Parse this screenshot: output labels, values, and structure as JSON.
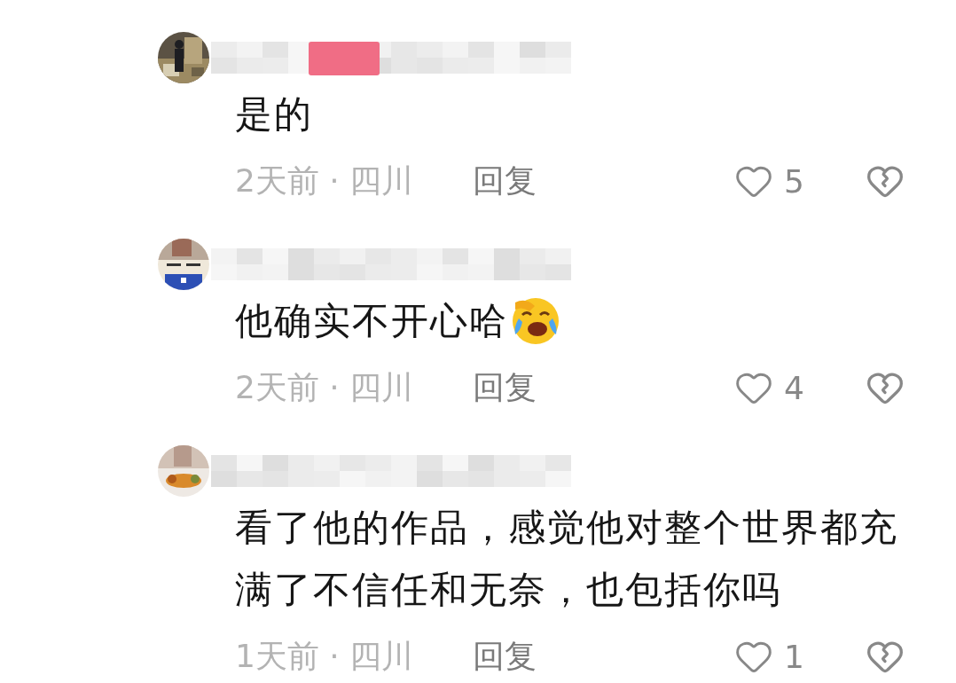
{
  "comments": [
    {
      "text": "是的",
      "emoji": false,
      "time": "2天前 · 四川",
      "reply": "回复",
      "likes": "5"
    },
    {
      "text": "他确实不开心哈",
      "emoji": true,
      "time": "2天前 · 四川",
      "reply": "回复",
      "likes": "4"
    },
    {
      "text": "看了他的作品，感觉他对整个世界都充满了不信任和无奈，也包括你吗",
      "emoji": false,
      "time": "1天前 · 四川",
      "reply": "回复",
      "likes": "1"
    }
  ]
}
